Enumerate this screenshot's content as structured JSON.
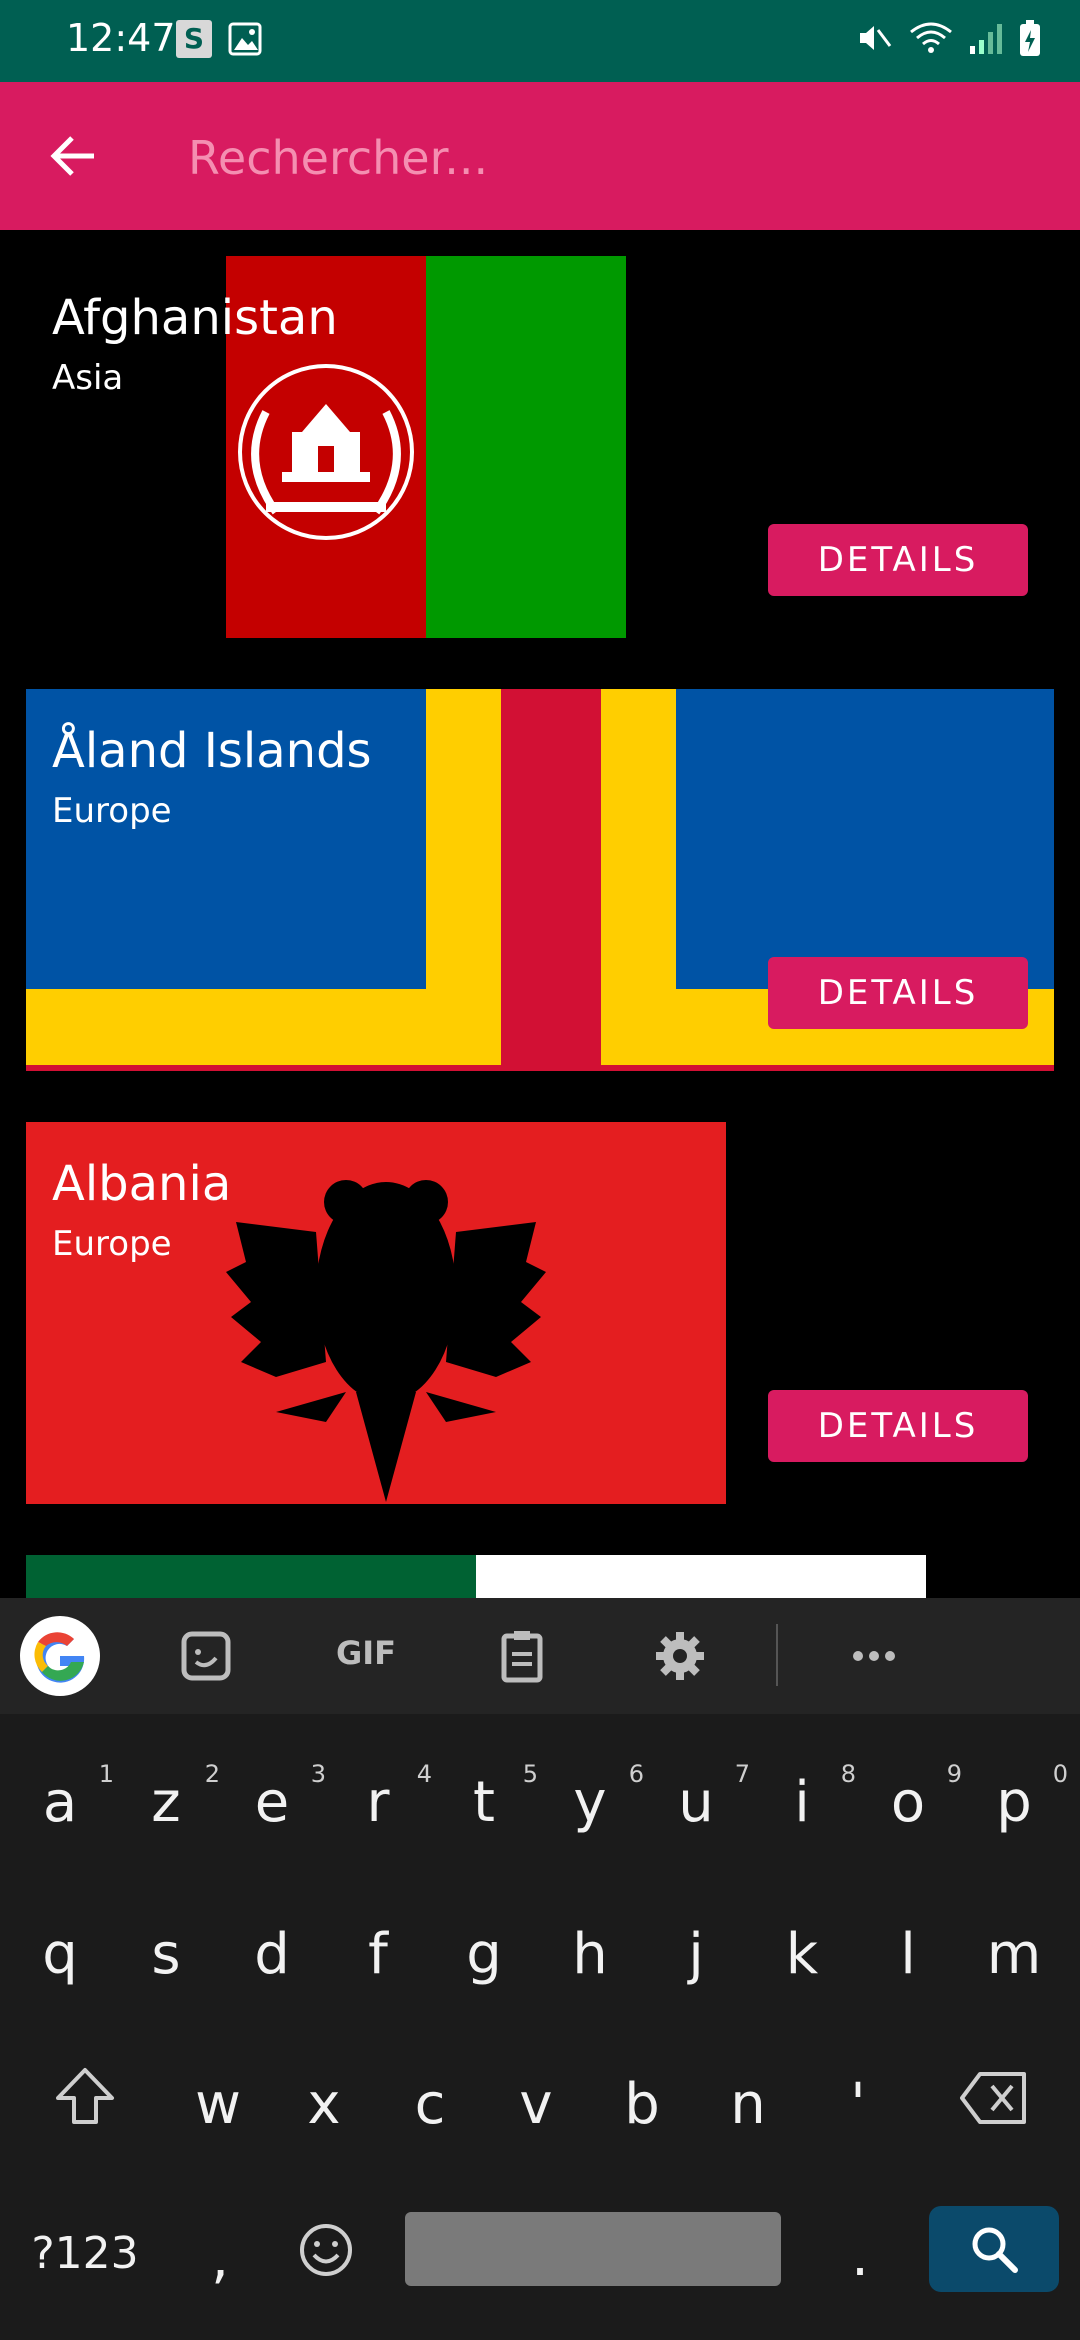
{
  "status_bar": {
    "time": "12:47",
    "s_badge": "S"
  },
  "search": {
    "placeholder": "Rechercher..."
  },
  "countries": [
    {
      "name": "Afghanistan",
      "region": "Asia",
      "button": "DETAILS"
    },
    {
      "name": "Åland Islands",
      "region": "Europe",
      "button": "DETAILS"
    },
    {
      "name": "Albania",
      "region": "Europe",
      "button": "DETAILS"
    }
  ],
  "keyboard": {
    "toolbar": {
      "gif_label": "GIF"
    },
    "row1": [
      {
        "k": "a",
        "n": "1"
      },
      {
        "k": "z",
        "n": "2"
      },
      {
        "k": "e",
        "n": "3"
      },
      {
        "k": "r",
        "n": "4"
      },
      {
        "k": "t",
        "n": "5"
      },
      {
        "k": "y",
        "n": "6"
      },
      {
        "k": "u",
        "n": "7"
      },
      {
        "k": "i",
        "n": "8"
      },
      {
        "k": "o",
        "n": "9"
      },
      {
        "k": "p",
        "n": "0"
      }
    ],
    "row2": [
      "q",
      "s",
      "d",
      "f",
      "g",
      "h",
      "j",
      "k",
      "l",
      "m"
    ],
    "row3": [
      "w",
      "x",
      "c",
      "v",
      "b",
      "n",
      "'"
    ],
    "symbols_key": "?123",
    "comma_key": ",",
    "period_key": "."
  },
  "colors": {
    "status_bar": "#005f52",
    "app_bar": "#d81b60",
    "button": "#d81b60",
    "search_key": "#0b4a6b"
  }
}
